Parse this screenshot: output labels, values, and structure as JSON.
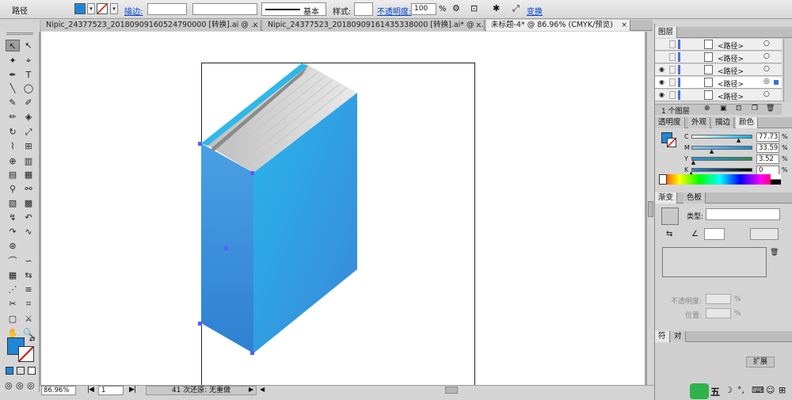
{
  "control_bar": {
    "selection_label": "路径",
    "stroke_label": "描边:",
    "brush_label": "基本",
    "style_label": "样式:",
    "opacity_label": "不透明度:",
    "opacity_value": "100",
    "opacity_unit": "%",
    "transform_label": "变换",
    "fill_color": "#1f86d6"
  },
  "tabs": [
    {
      "label": "Nipic_24377523_20180909160524790000 [转换].ai @ ..."
    },
    {
      "label": "Nipic_24377523_20180909161435338000 [转换].ai* @ ..."
    },
    {
      "label": "未标题-4* @ 86.96% (CMYK/预览)"
    }
  ],
  "tab_close_glyph": "×",
  "status_bar": {
    "zoom": "86.96%",
    "page": "1",
    "status_text": "41 次还原: 无重做"
  },
  "layers_panel": {
    "title": "图层",
    "rows": [
      {
        "name": "<路径>"
      },
      {
        "name": "<路径>"
      },
      {
        "name": "<路径>"
      },
      {
        "name": "<路径>"
      },
      {
        "name": "<路径>"
      }
    ],
    "footer": "1 个图层"
  },
  "color_panel": {
    "tabs": [
      "透明度",
      "外观",
      "描边",
      "颜色"
    ],
    "channels": [
      {
        "label": "C",
        "value": "77.73",
        "fraction": 0.777
      },
      {
        "label": "M",
        "value": "33.59",
        "fraction": 0.336
      },
      {
        "label": "Y",
        "value": "3.52",
        "fraction": 0.035
      },
      {
        "label": "K",
        "value": "0",
        "fraction": 0.0
      }
    ],
    "pct": "%"
  },
  "gradient_panel": {
    "tabs": [
      "渐变",
      "色板"
    ],
    "type_label": "类型:",
    "opacity_label": "不透明度:",
    "position_label": "位置:",
    "pct": "%"
  },
  "bottom_panel": {
    "tabs": [
      "符",
      "对"
    ],
    "expand_button": "扩展"
  },
  "ime": {
    "label": "五"
  },
  "tools": [
    {
      "glyph": "↖"
    },
    {
      "glyph": "↖"
    },
    {
      "glyph": "✦"
    },
    {
      "glyph": "⌖"
    },
    {
      "glyph": "✒"
    },
    {
      "glyph": "T"
    },
    {
      "glyph": "╲"
    },
    {
      "glyph": "◯"
    },
    {
      "glyph": "✎"
    },
    {
      "glyph": "✐"
    },
    {
      "glyph": "✏"
    },
    {
      "glyph": "◈"
    },
    {
      "glyph": "↻"
    },
    {
      "glyph": "⤢"
    },
    {
      "glyph": "⌇"
    },
    {
      "glyph": "⊞"
    },
    {
      "glyph": "⊕"
    },
    {
      "glyph": "▥"
    },
    {
      "glyph": "▤"
    },
    {
      "glyph": "▦"
    },
    {
      "glyph": "⚲"
    },
    {
      "glyph": "⚯"
    },
    {
      "glyph": "▧"
    },
    {
      "glyph": "▩"
    },
    {
      "glyph": "↯"
    },
    {
      "glyph": "↶"
    },
    {
      "glyph": "↷"
    },
    {
      "glyph": "∿"
    },
    {
      "glyph": "⊛"
    },
    {
      "glyph": " "
    },
    {
      "glyph": "⌒"
    },
    {
      "glyph": "∽"
    },
    {
      "glyph": "▦"
    },
    {
      "glyph": "⇆"
    },
    {
      "glyph": "⋰"
    },
    {
      "glyph": "≡"
    },
    {
      "glyph": "✂"
    },
    {
      "glyph": "⌗"
    },
    {
      "glyph": "▢"
    },
    {
      "glyph": "⚔"
    },
    {
      "glyph": "✋"
    },
    {
      "glyph": "🔍"
    }
  ]
}
